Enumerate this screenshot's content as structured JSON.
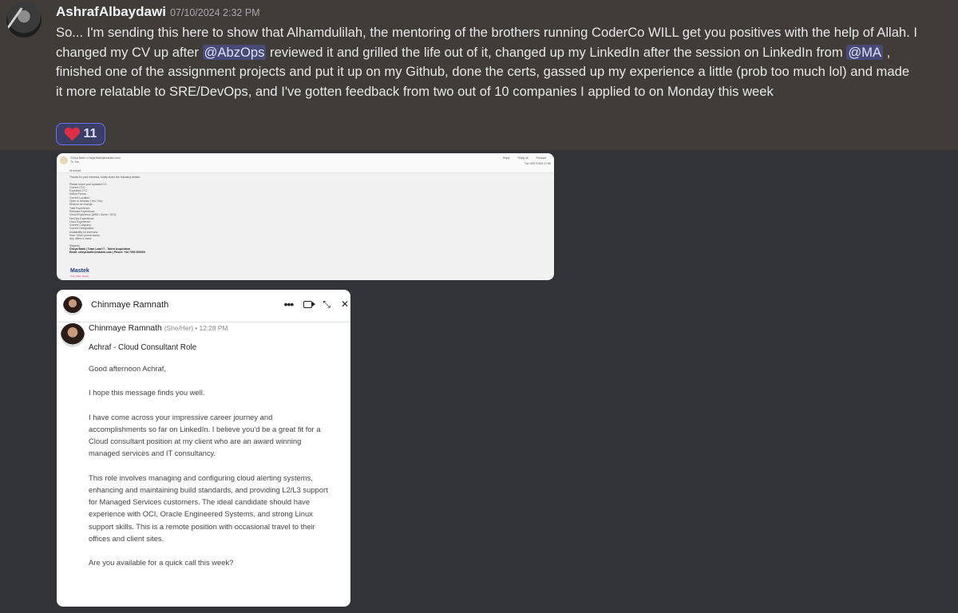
{
  "message": {
    "username": "AshrafAlbaydawi",
    "timestamp": "07/10/2024 2:32 PM",
    "text_part1": "So... I'm sending this here to show that Alhamdulilah, the mentoring of the brothers running CoderCo WILL get you positives with the help of Allah. I changed my CV up after ",
    "mention1": "@AbzOps",
    "text_part2": " reviewed it and grilled the life out of it, changed up my LinkedIn after the session on LinkedIn from ",
    "mention2": "@MA",
    "text_part3": " , finished one of the assignment projects and put it up on my Github, done the certs, gassed up my experience a little (prob too much lol) and made it more relatable to SRE/DevOps, and I've gotten feedback from two out of 10 companies I applied to on Monday this week",
    "reaction_count": "11"
  },
  "email": {
    "from": "Chirya Bathi <Chirya.Bathi@mastek.com>",
    "to": "To: You",
    "actions": [
      "Reply",
      "Reply all",
      "Forward"
    ],
    "date": "Tue 09/07/2024 17:56",
    "greeting": "Hi Ashraf,",
    "intro": "Thanks for your interests, kindly share the following details:",
    "fields": [
      "Please share your updated CV:",
      "Current CTC:",
      "Expected CTC:",
      "Notice Period:",
      "Current Location:",
      "Open to relocate (Yes / No):",
      "Reason for change:",
      "Total Experience:",
      "Relevant Experience:",
      "Cloud Experience (AWS / Azure / OCI):",
      "DevOps Experience:",
      "Linux Experience:",
      "Current Company:",
      "Current Designation:",
      "Availability for interview:",
      "Visa / Work permit status:",
      "Any offers in hand:"
    ],
    "regards": "Regards,",
    "sig_name": "Chirya Bathi | Team Lead IT - Talent Acquisition",
    "sig_contact": "Email: chirya.bathi@mastek.com | Phone: +44 7000 000000",
    "company": "Mastek",
    "company_tag": "Trust. Value. Velocity"
  },
  "linkedin": {
    "header_name": "Chinmaye Ramnath",
    "sender": "Chinmaye Ramnath",
    "pronoun_time": "(She/Her) • 12:28 PM",
    "subject": "Achraf - Cloud Consultant Role",
    "p1": "Good afternoon Achraf,",
    "p2": "I hope this message finds you well.",
    "p3": "I have come across your impressive career journey and accomplishments so far on LinkedIn. I believe you'd be a great fit for a Cloud consultant position at my client who are an award winning managed services and IT consultancy.",
    "p4": "This role involves managing and configuring cloud alerting systems, enhancing and maintaining build standards, and providing L2/L3 support for Managed Services customers. The ideal candidate should have experience with OCI, Oracle Engineered Systems, and strong Linux support skills. This is a remote position with occasional travel to their offices and client sites.",
    "p5": "Are you available for a quick call this week?"
  },
  "icons": {
    "heart": "red-heart",
    "more": "more-dots-icon",
    "video": "video-call-icon",
    "minimize": "minimize-icon",
    "close": "close-icon"
  },
  "colors": {
    "discord_bg": "#313338",
    "highlight_bg": "#403d38",
    "mention": "#5865f2",
    "heart": "#dd2e44"
  }
}
